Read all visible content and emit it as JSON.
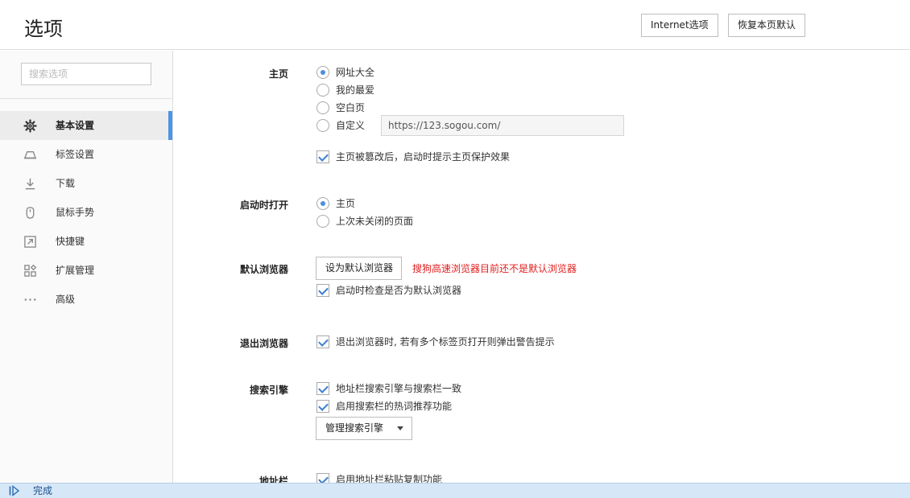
{
  "header": {
    "title": "选项",
    "internet_options_label": "Internet选项",
    "restore_defaults_label": "恢复本页默认"
  },
  "sidebar": {
    "search_placeholder": "搜索选项",
    "items": [
      {
        "label": "基本设置",
        "icon": "gear-icon",
        "active": true
      },
      {
        "label": "标签设置",
        "icon": "tab-icon",
        "active": false
      },
      {
        "label": "下载",
        "icon": "download-icon",
        "active": false
      },
      {
        "label": "鼠标手势",
        "icon": "mouse-icon",
        "active": false
      },
      {
        "label": "快捷键",
        "icon": "shortcut-icon",
        "active": false
      },
      {
        "label": "扩展管理",
        "icon": "extensions-icon",
        "active": false
      },
      {
        "label": "高级",
        "icon": "more-icon",
        "active": false
      }
    ]
  },
  "homepage": {
    "label": "主页",
    "options": [
      {
        "label": "网址大全",
        "selected": true
      },
      {
        "label": "我的最爱",
        "selected": false
      },
      {
        "label": "空白页",
        "selected": false
      },
      {
        "label": "自定义",
        "selected": false
      }
    ],
    "custom_url": "https://123.sogou.com/",
    "protect_label": "主页被篡改后，启动时提示主页保护效果",
    "protect_checked": true
  },
  "startup": {
    "label": "启动时打开",
    "options": [
      {
        "label": "主页",
        "selected": true
      },
      {
        "label": "上次未关闭的页面",
        "selected": false
      }
    ]
  },
  "default_browser": {
    "label": "默认浏览器",
    "button_label": "设为默认浏览器",
    "warning": "搜狗高速浏览器目前还不是默认浏览器",
    "check_label": "启动时检查是否为默认浏览器",
    "check_checked": true
  },
  "exit_browser": {
    "label": "退出浏览器",
    "check_label": "退出浏览器时, 若有多个标签页打开则弹出警告提示",
    "check_checked": true
  },
  "search_engine": {
    "label": "搜索引擎",
    "check1_label": "地址栏搜索引擎与搜索栏一致",
    "check1_checked": true,
    "check2_label": "启用搜索栏的热词推荐功能",
    "check2_checked": true,
    "manage_label": "管理搜索引擎"
  },
  "address_bar": {
    "label": "地址栏",
    "check_label": "启用地址栏粘贴复制功能",
    "check_checked": true
  },
  "status": {
    "text": "完成"
  },
  "colors": {
    "accent": "#4d94e6",
    "warning": "#e02020",
    "statusbar": "#d6e7f8"
  }
}
